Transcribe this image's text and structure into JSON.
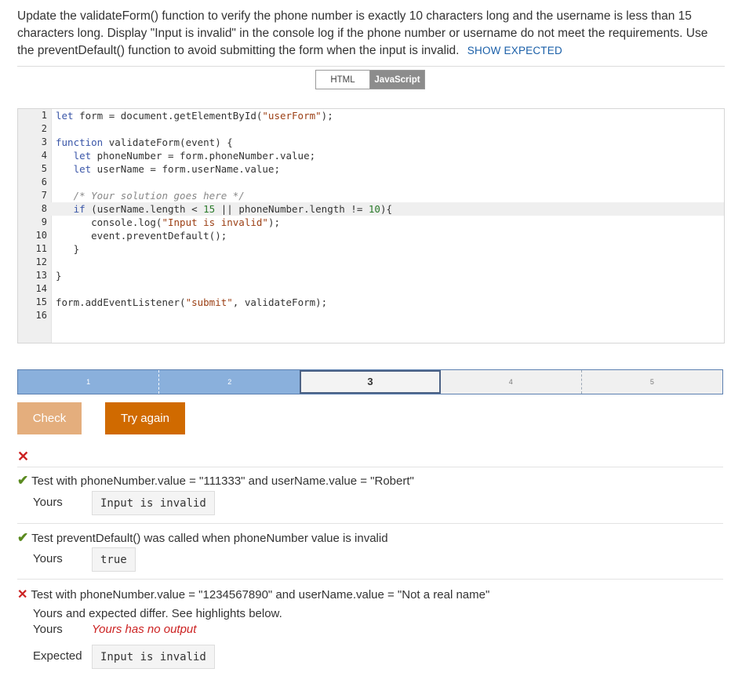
{
  "prompt": {
    "text": "Update the validateForm() function to verify the phone number is exactly 10 characters long and the username is less than 15 characters long. Display \"Input is invalid\" in the console log if the phone number or username do not meet the requirements. Use the preventDefault() function to avoid submitting the form when the input is invalid.",
    "show_expected": "SHOW EXPECTED"
  },
  "tabs": {
    "html": "HTML",
    "javascript": "JavaScript"
  },
  "editor": {
    "line_numbers": [
      "1",
      "2",
      "3",
      "4",
      "5",
      "6",
      "7",
      "8",
      "9",
      "10",
      "11",
      "12",
      "13",
      "14",
      "15",
      "16"
    ],
    "lines": [
      "let form = document.getElementById(\"userForm\");",
      "",
      "function validateForm(event) {",
      "   let phoneNumber = form.phoneNumber.value;",
      "   let userName = form.userName.value;",
      "",
      "   /* Your solution goes here */",
      "   if (userName.length < 15 || phoneNumber.length != 10){",
      "      console.log(\"Input is invalid\");",
      "      event.preventDefault();",
      "   }",
      "",
      "}",
      "",
      "form.addEventListener(\"submit\", validateForm);",
      ""
    ],
    "active_line": 8
  },
  "progress": {
    "levels": [
      "1",
      "2",
      "3",
      "4",
      "5"
    ],
    "current": 3,
    "completed": 2
  },
  "buttons": {
    "check": "Check",
    "try_again": "Try again"
  },
  "results": {
    "status_icon": "x-icon",
    "tests": [
      {
        "status": "pass",
        "title": "Test with phoneNumber.value = \"111333\" and userName.value = \"Robert\"",
        "yours_label": "Yours",
        "yours_value": "Input is invalid"
      },
      {
        "status": "pass",
        "title": "Test preventDefault() was called when phoneNumber value is invalid",
        "yours_label": "Yours",
        "yours_value": "true"
      },
      {
        "status": "fail",
        "title": "Test with phoneNumber.value = \"1234567890\" and userName.value = \"Not a real name\"",
        "diff_message": "Yours and expected differ. See highlights below.",
        "yours_label": "Yours",
        "yours_value": "Yours has no output",
        "expected_label": "Expected",
        "expected_value": "Input is invalid"
      }
    ]
  },
  "colors": {
    "accent_blue": "#1a5fa8",
    "check_button": "#e4ae7d",
    "try_again_button": "#d06a00",
    "pass_green": "#5a8a1f",
    "fail_red": "#c22222",
    "progress_done": "#8ab0dc"
  }
}
